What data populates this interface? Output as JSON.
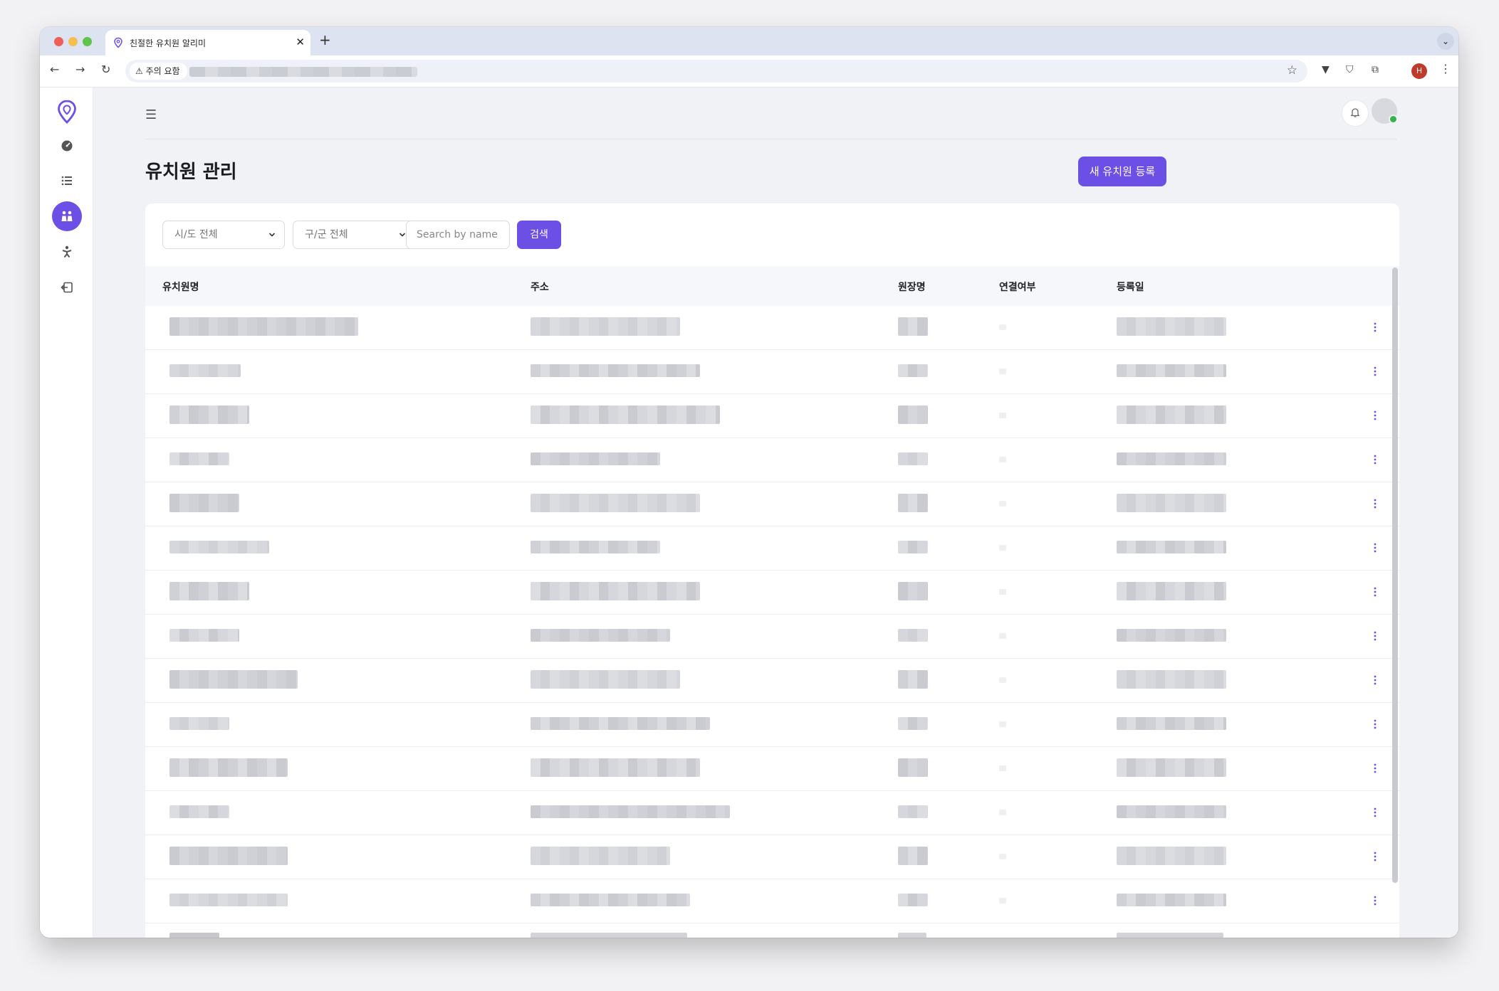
{
  "browser": {
    "tab_title": "친절한 유치원 알리미",
    "security_chip": "주의 요함",
    "profile_initial": "H"
  },
  "app": {
    "page_title": "유치원 관리",
    "new_button": "새 유치원 등록",
    "accent_color": "#6c4fe4"
  },
  "filters": {
    "sido": "시/도 전체",
    "gugun": "구/군 전체",
    "search_placeholder": "Search by name",
    "search_button": "검색"
  },
  "table": {
    "columns": [
      "유치원명",
      "주소",
      "원장명",
      "연결여부",
      "등록일"
    ]
  },
  "sidebar": {
    "items": [
      "dashboard-icon",
      "list-icon",
      "people-icon",
      "child-icon",
      "logout-icon"
    ],
    "active_index": 2
  }
}
